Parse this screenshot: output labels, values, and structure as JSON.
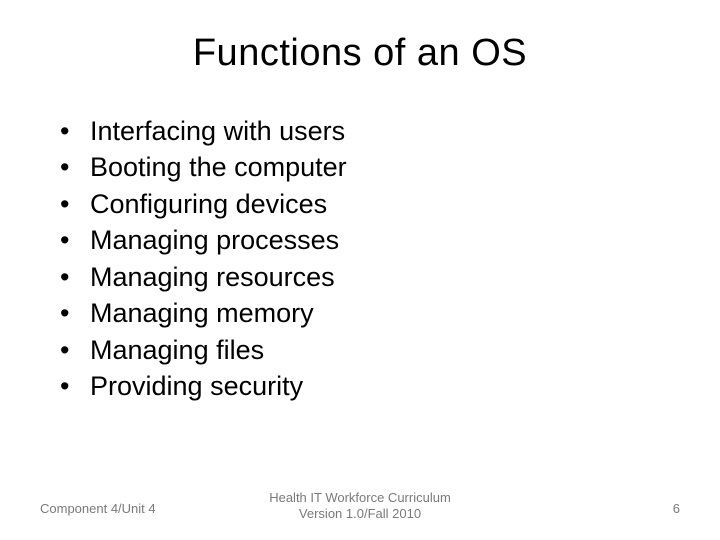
{
  "title": "Functions of an OS",
  "bullets": [
    "Interfacing with users",
    "Booting the computer",
    "Configuring devices",
    "Managing processes",
    "Managing resources",
    "Managing memory",
    "Managing files",
    "Providing security"
  ],
  "footer": {
    "left": "Component 4/Unit 4",
    "center_line1": "Health IT Workforce Curriculum",
    "center_line2": "Version 1.0/Fall 2010",
    "right": "6"
  }
}
